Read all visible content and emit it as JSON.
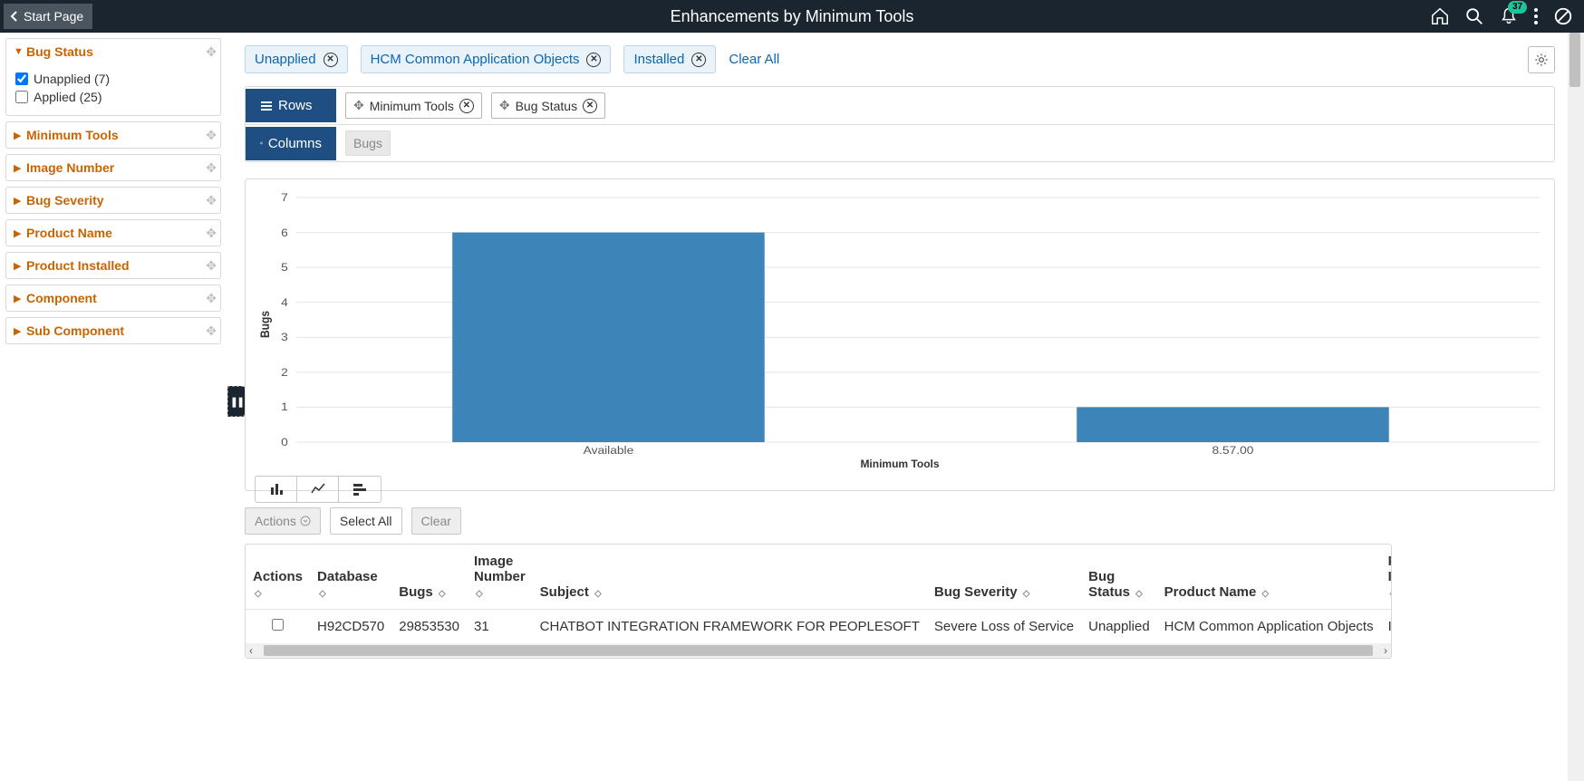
{
  "header": {
    "back_label": "Start Page",
    "title": "Enhancements by Minimum Tools",
    "notif_count": "37"
  },
  "facets": [
    {
      "name": "Bug Status",
      "expanded": true,
      "options": [
        {
          "label": "Unapplied (7)",
          "checked": true
        },
        {
          "label": "Applied (25)",
          "checked": false
        }
      ]
    },
    {
      "name": "Minimum Tools",
      "expanded": false
    },
    {
      "name": "Image Number",
      "expanded": false
    },
    {
      "name": "Bug Severity",
      "expanded": false
    },
    {
      "name": "Product Name",
      "expanded": false
    },
    {
      "name": "Product Installed",
      "expanded": false
    },
    {
      "name": "Component",
      "expanded": false
    },
    {
      "name": "Sub Component",
      "expanded": false
    }
  ],
  "chips": {
    "items": [
      "Unapplied",
      "HCM Common Application Objects",
      "Installed"
    ],
    "clear_label": "Clear All"
  },
  "rc": {
    "rows_label": "Rows",
    "cols_label": "Columns",
    "row_tags": [
      "Minimum Tools",
      "Bug Status"
    ],
    "col_tags": [
      "Bugs"
    ]
  },
  "chart_data": {
    "type": "bar",
    "categories": [
      "Available",
      "8.57.00"
    ],
    "values": [
      6,
      1
    ],
    "xlabel": "Minimum Tools",
    "ylabel": "Bugs",
    "ylim": [
      0,
      7
    ],
    "yticks": [
      0,
      1,
      2,
      3,
      4,
      5,
      6,
      7
    ]
  },
  "toolbar": {
    "actions": "Actions",
    "select_all": "Select All",
    "clear": "Clear"
  },
  "table": {
    "columns": [
      "Actions",
      "Database",
      "Bugs",
      "Image Number",
      "Subject",
      "Bug Severity",
      "Bug Status",
      "Product Name",
      "Product Installed"
    ],
    "rows": [
      {
        "database": "H92CD570",
        "bugs": "29853530",
        "image_number": "31",
        "subject": "CHATBOT INTEGRATION FRAMEWORK FOR PEOPLESOFT",
        "bug_severity": "Severe Loss of Service",
        "bug_status": "Unapplied",
        "product_name": "HCM Common Application Objects",
        "product_installed": "Installed"
      }
    ]
  }
}
